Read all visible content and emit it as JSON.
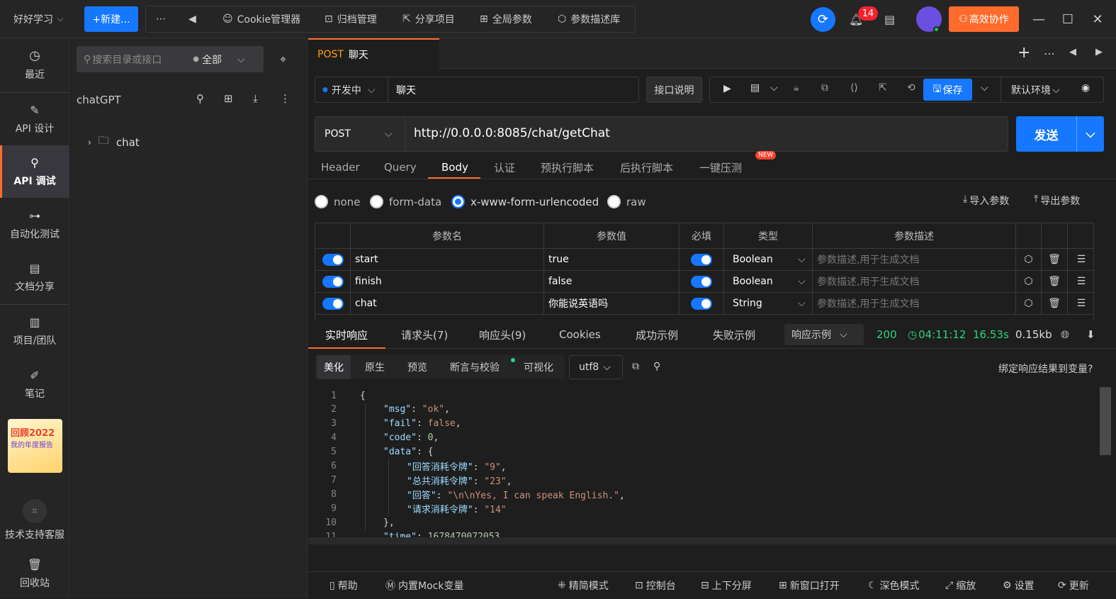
{
  "topbar": {
    "workspace": "好好学习",
    "new_button": "+新建...",
    "tools": [
      {
        "label": "Cookie管理器",
        "icon": "cookie-icon"
      },
      {
        "label": "归档管理",
        "icon": "archive-icon"
      },
      {
        "label": "分享项目",
        "icon": "share-icon"
      },
      {
        "label": "全局参数",
        "icon": "params-icon"
      },
      {
        "label": "参数描述库",
        "icon": "cube-icon"
      }
    ],
    "notification_count": "14",
    "collab_button": "高效协作"
  },
  "nav": {
    "items": [
      {
        "label": "最近",
        "icon": "history-icon"
      },
      {
        "label": "API 设计",
        "icon": "edit-icon"
      },
      {
        "label": "API 调试",
        "icon": "link-icon"
      },
      {
        "label": "自动化测试",
        "icon": "flow-icon"
      },
      {
        "label": "文档分享",
        "icon": "doc-icon"
      },
      {
        "label": "项目/团队",
        "icon": "project-icon"
      },
      {
        "label": "笔记",
        "icon": "note-icon"
      }
    ],
    "promo": {
      "line1": "回顾2022",
      "line2": "我的年度报告"
    },
    "support": "技术支持客服",
    "trash": "回收站"
  },
  "tree": {
    "search_placeholder": "搜索目录或接口",
    "filter": "全部",
    "project": "chatGPT",
    "folder": "chat"
  },
  "request_tab": {
    "method": "POST",
    "name": "聊天"
  },
  "request": {
    "status": "开发中",
    "name": "聊天",
    "doc_button": "接口说明",
    "save_button": "保存",
    "env": "默认环境",
    "method": "POST",
    "url": "http://0.0.0.0:8085/chat/getChat",
    "send_button": "发送"
  },
  "param_tabs": [
    "Header",
    "Query",
    "Body",
    "认证",
    "预执行脚本",
    "后执行脚本",
    "一键压测"
  ],
  "new_badge": "NEW",
  "body_types": [
    "none",
    "form-data",
    "x-www-form-urlencoded",
    "raw"
  ],
  "import_params": "导入参数",
  "export_params": "导出参数",
  "param_table": {
    "headers": [
      "参数名",
      "参数值",
      "必填",
      "类型",
      "参数描述"
    ],
    "desc_placeholder": "参数描述,用于生成文档",
    "rows": [
      {
        "name": "start",
        "value": "true",
        "type": "Boolean"
      },
      {
        "name": "finish",
        "value": "false",
        "type": "Boolean"
      },
      {
        "name": "chat",
        "value": "你能说英语吗",
        "type": "String"
      }
    ]
  },
  "response": {
    "tabs": [
      "实时响应",
      "请求头(7)",
      "响应头(9)",
      "Cookies",
      "成功示例",
      "失败示例"
    ],
    "example_select": "响应示例",
    "status_code": "200",
    "time": "04:11:12",
    "duration": "16.53s",
    "size": "0.15kb",
    "sub_tabs": [
      "美化",
      "原生",
      "预览",
      "断言与校验",
      "可视化"
    ],
    "encoding": "utf8",
    "bind_var": "绑定响应结果到变量?"
  },
  "code_lines": [
    {
      "n": "1",
      "indent": 0,
      "parts": [
        {
          "t": "{",
          "c": ""
        }
      ]
    },
    {
      "n": "2",
      "indent": 1,
      "parts": [
        {
          "t": "\"msg\"",
          "c": "k"
        },
        {
          "t": ": ",
          "c": ""
        },
        {
          "t": "\"ok\"",
          "c": "s"
        },
        {
          "t": ",",
          "c": ""
        }
      ]
    },
    {
      "n": "3",
      "indent": 1,
      "parts": [
        {
          "t": "\"fail\"",
          "c": "k"
        },
        {
          "t": ": ",
          "c": ""
        },
        {
          "t": "false",
          "c": "s"
        },
        {
          "t": ",",
          "c": ""
        }
      ]
    },
    {
      "n": "4",
      "indent": 1,
      "parts": [
        {
          "t": "\"code\"",
          "c": "k"
        },
        {
          "t": ": ",
          "c": ""
        },
        {
          "t": "0",
          "c": "n"
        },
        {
          "t": ",",
          "c": ""
        }
      ]
    },
    {
      "n": "5",
      "indent": 1,
      "parts": [
        {
          "t": "\"data\"",
          "c": "k"
        },
        {
          "t": ": {",
          "c": ""
        }
      ]
    },
    {
      "n": "6",
      "indent": 2,
      "parts": [
        {
          "t": "\"回答消耗令牌\"",
          "c": "k"
        },
        {
          "t": ": ",
          "c": ""
        },
        {
          "t": "\"9\"",
          "c": "s"
        },
        {
          "t": ",",
          "c": ""
        }
      ]
    },
    {
      "n": "7",
      "indent": 2,
      "parts": [
        {
          "t": "\"总共消耗令牌\"",
          "c": "k"
        },
        {
          "t": ": ",
          "c": ""
        },
        {
          "t": "\"23\"",
          "c": "s"
        },
        {
          "t": ",",
          "c": ""
        }
      ]
    },
    {
      "n": "8",
      "indent": 2,
      "parts": [
        {
          "t": "\"回答\"",
          "c": "k"
        },
        {
          "t": ": ",
          "c": ""
        },
        {
          "t": "\"\\n\\nYes, I can speak English.\"",
          "c": "s"
        },
        {
          "t": ",",
          "c": ""
        }
      ]
    },
    {
      "n": "9",
      "indent": 2,
      "parts": [
        {
          "t": "\"请求消耗令牌\"",
          "c": "k"
        },
        {
          "t": ": ",
          "c": ""
        },
        {
          "t": "\"14\"",
          "c": "s"
        }
      ]
    },
    {
      "n": "10",
      "indent": 1,
      "parts": [
        {
          "t": "},",
          "c": ""
        }
      ]
    },
    {
      "n": "11",
      "indent": 1,
      "parts": [
        {
          "t": "\"time\"",
          "c": "k"
        },
        {
          "t": ": ",
          "c": ""
        },
        {
          "t": "1678470072053",
          "c": "n"
        }
      ]
    }
  ],
  "statusbar": [
    {
      "label": "帮助",
      "icon": "book-icon"
    },
    {
      "label": "内置Mock变量",
      "icon": "mock-icon"
    },
    {
      "label": "精简模式",
      "icon": "compact-icon"
    },
    {
      "label": "控制台",
      "icon": "console-icon"
    },
    {
      "label": "上下分屏",
      "icon": "split-icon"
    },
    {
      "label": "新窗口打开",
      "icon": "window-icon"
    },
    {
      "label": "深色模式",
      "icon": "moon-icon"
    },
    {
      "label": "缩放",
      "icon": "zoom-icon"
    },
    {
      "label": "设置",
      "icon": "gear-icon"
    },
    {
      "label": "更新",
      "icon": "update-icon"
    }
  ]
}
